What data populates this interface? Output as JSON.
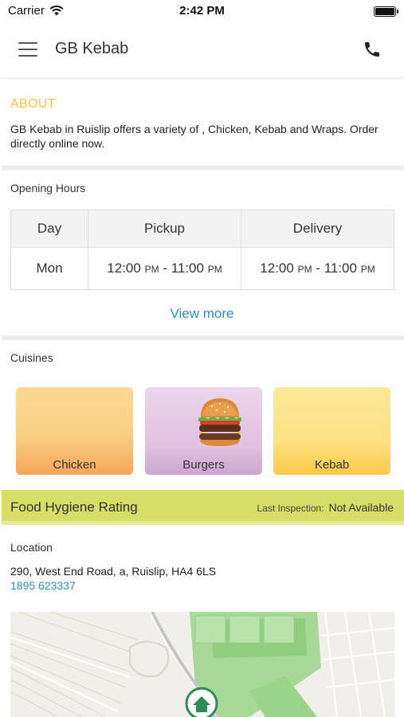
{
  "status_bar": {
    "carrier": "Carrier",
    "time": "2:42 PM"
  },
  "nav": {
    "title": "GB Kebab"
  },
  "about": {
    "title": "ABOUT",
    "text": "GB Kebab in Ruislip offers a variety of , Chicken, Kebab and  Wraps. Order directly online now."
  },
  "opening_hours": {
    "title": "Opening Hours",
    "headers": [
      "Day",
      "Pickup",
      "Delivery"
    ],
    "rows": [
      {
        "day": "Mon",
        "pickup_from": "12:00",
        "pickup_to": "11:00",
        "delivery_from": "12:00",
        "delivery_to": "11:00",
        "pm": "PM",
        "sep": " - "
      }
    ],
    "view_more": "View more"
  },
  "cuisines": {
    "title": "Cuisines",
    "items": [
      {
        "label": "Chicken"
      },
      {
        "label": "Burgers"
      },
      {
        "label": "Kebab"
      }
    ]
  },
  "hygiene": {
    "title": "Food Hygiene Rating",
    "inspection_label": "Last Inspection:",
    "inspection_value": "Not Available"
  },
  "location": {
    "title": "Location",
    "address": "290, West End Road, a, Ruislip, HA4 6LS",
    "phone": "1895 623337"
  },
  "colors": {
    "accent_link": "#2f8fbf",
    "about_title": "#e9c84a",
    "hygiene_bar": "#d6de68"
  }
}
